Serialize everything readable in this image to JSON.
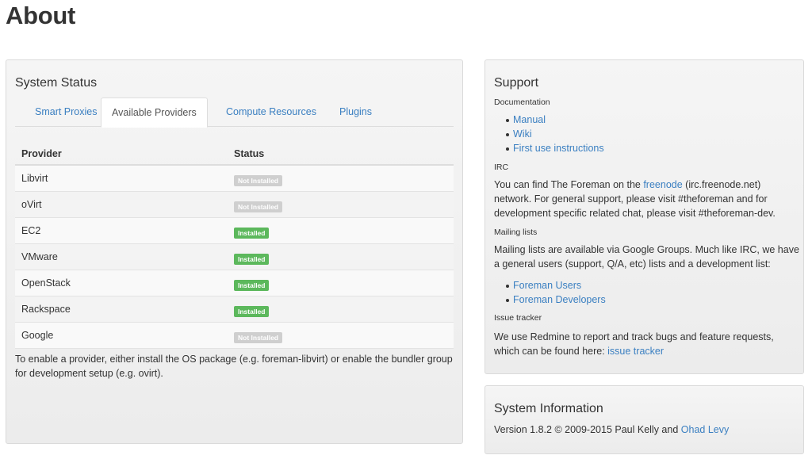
{
  "page": {
    "title": "About"
  },
  "system_status": {
    "heading": "System Status",
    "tabs": [
      {
        "label": "Smart Proxies",
        "active": false
      },
      {
        "label": "Available Providers",
        "active": true
      },
      {
        "label": "Compute Resources",
        "active": false
      },
      {
        "label": "Plugins",
        "active": false
      }
    ],
    "table": {
      "headers": [
        "Provider",
        "Status"
      ],
      "rows": [
        {
          "provider": "Libvirt",
          "status": "Not Installed",
          "installed": false
        },
        {
          "provider": "oVirt",
          "status": "Not Installed",
          "installed": false
        },
        {
          "provider": "EC2",
          "status": "Installed",
          "installed": true
        },
        {
          "provider": "VMware",
          "status": "Installed",
          "installed": true
        },
        {
          "provider": "OpenStack",
          "status": "Installed",
          "installed": true
        },
        {
          "provider": "Rackspace",
          "status": "Installed",
          "installed": true
        },
        {
          "provider": "Google",
          "status": "Not Installed",
          "installed": false
        }
      ]
    },
    "footnote": "To enable a provider, either install the OS package (e.g. foreman-libvirt) or enable the bundler group for development setup (e.g. ovirt)."
  },
  "support": {
    "heading": "Support",
    "documentation": {
      "title": "Documentation",
      "links": [
        "Manual",
        "Wiki",
        "First use instructions"
      ]
    },
    "irc": {
      "title": "IRC",
      "text_before": "You can find The Foreman on the ",
      "link": "freenode",
      "text_after": " (irc.freenode.net) network. For general support, please visit #theforeman and for development specific related chat, please visit #theforeman-dev."
    },
    "mailing_lists": {
      "title": "Mailing lists",
      "text": "Mailing lists are available via Google Groups. Much like IRC, we have a general users (support, Q/A, etc) lists and a development list:",
      "links": [
        "Foreman Users",
        "Foreman Developers"
      ]
    },
    "issue_tracker": {
      "title": "Issue tracker",
      "text_before": "We use Redmine to report and track bugs and feature requests, which can be found here: ",
      "link": "issue tracker"
    }
  },
  "system_information": {
    "heading": "System Information",
    "text_before": "Version 1.8.2 © 2009-2015 Paul Kelly and ",
    "link": "Ohad Levy"
  },
  "colors": {
    "link": "#3a7fc1",
    "installed": "#5cb85c",
    "not_installed": "#cfcfcf"
  }
}
